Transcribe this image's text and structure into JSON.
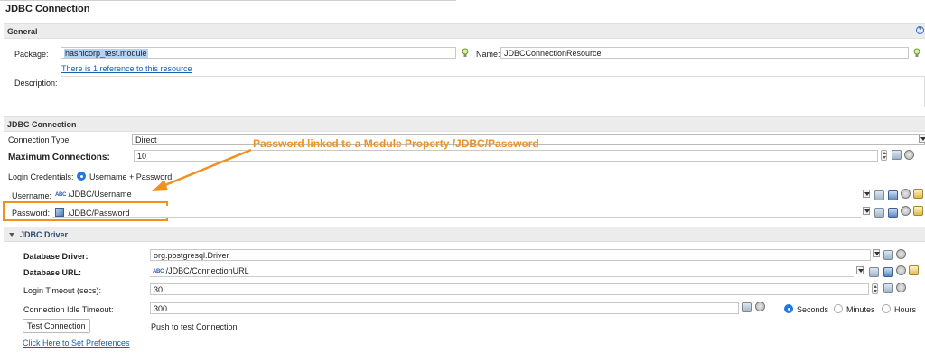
{
  "header": {
    "title": "JDBC Connection"
  },
  "general": {
    "section_label": "General",
    "package_label": "Package:",
    "package_value": "hashicorp_test.module",
    "name_label": "Name:",
    "name_value": "JDBCConnectionResource",
    "reference_link": "There is 1 reference to this resource",
    "description_label": "Description:",
    "description_value": ""
  },
  "jdbc_connection": {
    "section_label": "JDBC Connection",
    "connection_type_label": "Connection Type:",
    "connection_type_value": "Direct",
    "max_connections_label": "Maximum Connections:",
    "max_connections_value": "10",
    "login_credentials_label": "Login Credentials:",
    "login_credentials_option": "Username + Password",
    "username_label": "Username:",
    "username_value": "/JDBC/Username",
    "password_label": "Password:",
    "password_value": "/JDBC/Password"
  },
  "annotation": {
    "text": "Password linked to a Module Property /JDBC/Password",
    "color": "#f0901e"
  },
  "jdbc_driver": {
    "section_label": "JDBC Driver",
    "driver_label": "Database Driver:",
    "driver_value": "org.postgresql.Driver",
    "url_label": "Database URL:",
    "url_value": "/JDBC/ConnectionURL",
    "login_timeout_label": "Login Timeout (secs):",
    "login_timeout_value": "30",
    "idle_timeout_label": "Connection Idle Timeout:",
    "idle_timeout_value": "300",
    "units": [
      "Seconds",
      "Minutes",
      "Hours"
    ],
    "selected_unit": "Seconds",
    "test_button": "Test Connection",
    "test_hint": "Push to test Connection",
    "preferences_link": "Click Here to Set Preferences"
  },
  "colors": {
    "accent": "#1f78e6",
    "selection": "#b4d2f5",
    "link": "#1a5fb4"
  },
  "icons": [
    "lightbulb-icon",
    "help-icon",
    "abc-string-icon",
    "module-property-icon",
    "gear-icon",
    "clear-icon",
    "dropdown-icon",
    "spinner-icon"
  ]
}
